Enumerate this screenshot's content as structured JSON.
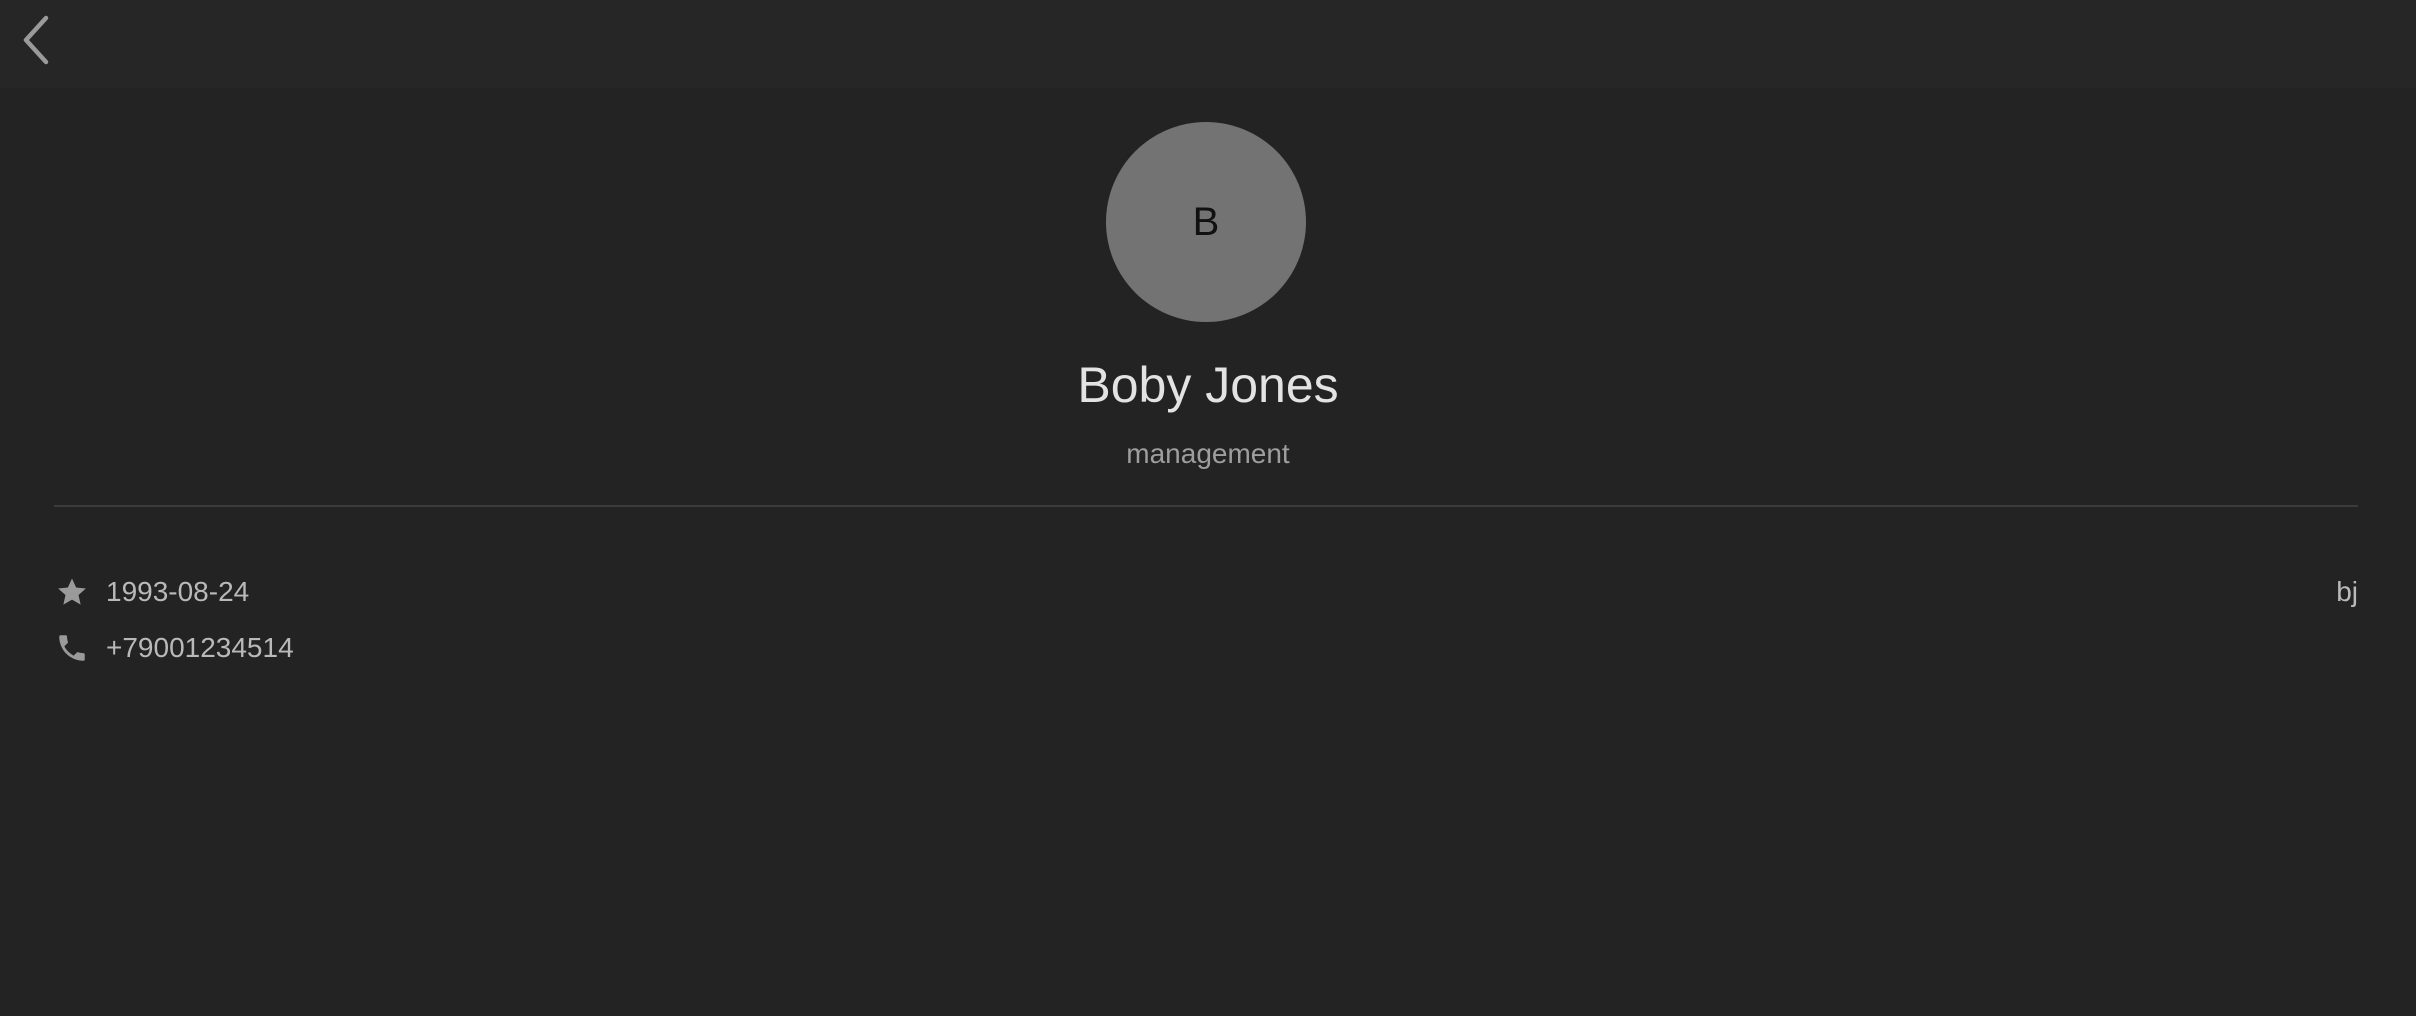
{
  "header": {
    "back_icon": "chevron-left-icon"
  },
  "contact": {
    "avatar_initial": "B",
    "name": "Boby Jones",
    "department": "management",
    "birthday": "1993-08-24",
    "birthday_icon": "star-icon",
    "phone": "+79001234514",
    "phone_icon": "phone-icon",
    "nickname": "bj"
  },
  "colors": {
    "background": "#232323",
    "topbar": "#262626",
    "avatar": "#737373",
    "primary_text": "#e3e3e3",
    "secondary_text": "#9e9e9e",
    "icon": "#9a9a9a"
  }
}
